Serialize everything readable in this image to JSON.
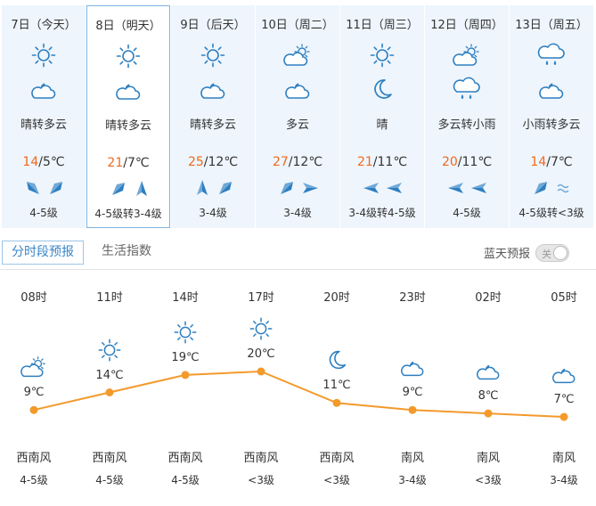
{
  "colors": {
    "accent": "#f39a2b",
    "high_temp": "#f06a1b",
    "icon_blue": "#2d7fc1",
    "selected_border": "#7fb4df",
    "card_bg": "#eef5fc"
  },
  "days": [
    {
      "label": "7日（今天）",
      "icon_top": "sun-icon",
      "icon_bottom": "moon-cloud-icon",
      "desc": "晴转多云",
      "high": "14",
      "low": "/5℃",
      "wind_icons": [
        "arrow-nw-icon",
        "arrow-ne-icon"
      ],
      "wind": "4-5级"
    },
    {
      "label": "8日（明天）",
      "icon_top": "sun-icon",
      "icon_bottom": "moon-cloud-icon",
      "desc": "晴转多云",
      "high": "21",
      "low": "/7℃",
      "wind_icons": [
        "arrow-ne-icon",
        "arrow-n-icon"
      ],
      "wind": "4-5级转3-4级"
    },
    {
      "label": "9日（后天）",
      "icon_top": "sun-icon",
      "icon_bottom": "moon-cloud-icon",
      "desc": "晴转多云",
      "high": "25",
      "low": "/12℃",
      "wind_icons": [
        "arrow-n-icon",
        "arrow-ne-icon"
      ],
      "wind": "3-4级"
    },
    {
      "label": "10日（周二）",
      "icon_top": "sun-cloud-icon",
      "icon_bottom": "moon-cloud-icon",
      "desc": "多云",
      "high": "27",
      "low": "/12℃",
      "wind_icons": [
        "arrow-ne-icon",
        "arrow-e-icon"
      ],
      "wind": "3-4级"
    },
    {
      "label": "11日（周三）",
      "icon_top": "sun-icon",
      "icon_bottom": "moon-icon",
      "desc": "晴",
      "high": "21",
      "low": "/11℃",
      "wind_icons": [
        "arrow-w-icon",
        "arrow-w-icon"
      ],
      "wind": "3-4级转4-5级"
    },
    {
      "label": "12日（周四）",
      "icon_top": "sun-cloud-icon",
      "icon_bottom": "rain-cloud-icon",
      "desc": "多云转小雨",
      "high": "20",
      "low": "/11℃",
      "wind_icons": [
        "arrow-w-icon",
        "arrow-w-icon"
      ],
      "wind": "4-5级"
    },
    {
      "label": "13日（周五）",
      "icon_top": "rain-cloud-icon",
      "icon_bottom": "moon-cloud-icon",
      "desc": "小雨转多云",
      "high": "14",
      "low": "/7℃",
      "wind_icons": [
        "arrow-ne-icon",
        "wave-icon"
      ],
      "wind": "4-5级转<3级"
    }
  ],
  "tabs": {
    "active": "分时段预报",
    "inactive": "生活指数"
  },
  "blue_sky": {
    "label": "蓝天预报",
    "toggle_text": "关"
  },
  "chart_data": {
    "type": "line",
    "x": [
      "08时",
      "11时",
      "14时",
      "17时",
      "20时",
      "23时",
      "02时",
      "05时"
    ],
    "series": [
      {
        "values": [
          9,
          14,
          19,
          20,
          11,
          9,
          8,
          7
        ]
      }
    ],
    "unit": "℃",
    "icons": [
      "sun-cloud-icon",
      "sun-icon",
      "sun-icon",
      "sun-icon",
      "moon-icon",
      "moon-cloud-icon",
      "moon-cloud-icon",
      "moon-cloud-icon"
    ],
    "wind_dir": [
      "西南风",
      "西南风",
      "西南风",
      "西南风",
      "西南风",
      "南风",
      "南风",
      "南风"
    ],
    "wind_level": [
      "4-5级",
      "4-5级",
      "4-5级",
      "<3级",
      "<3级",
      "3-4级",
      "<3级",
      "3-4级"
    ]
  }
}
